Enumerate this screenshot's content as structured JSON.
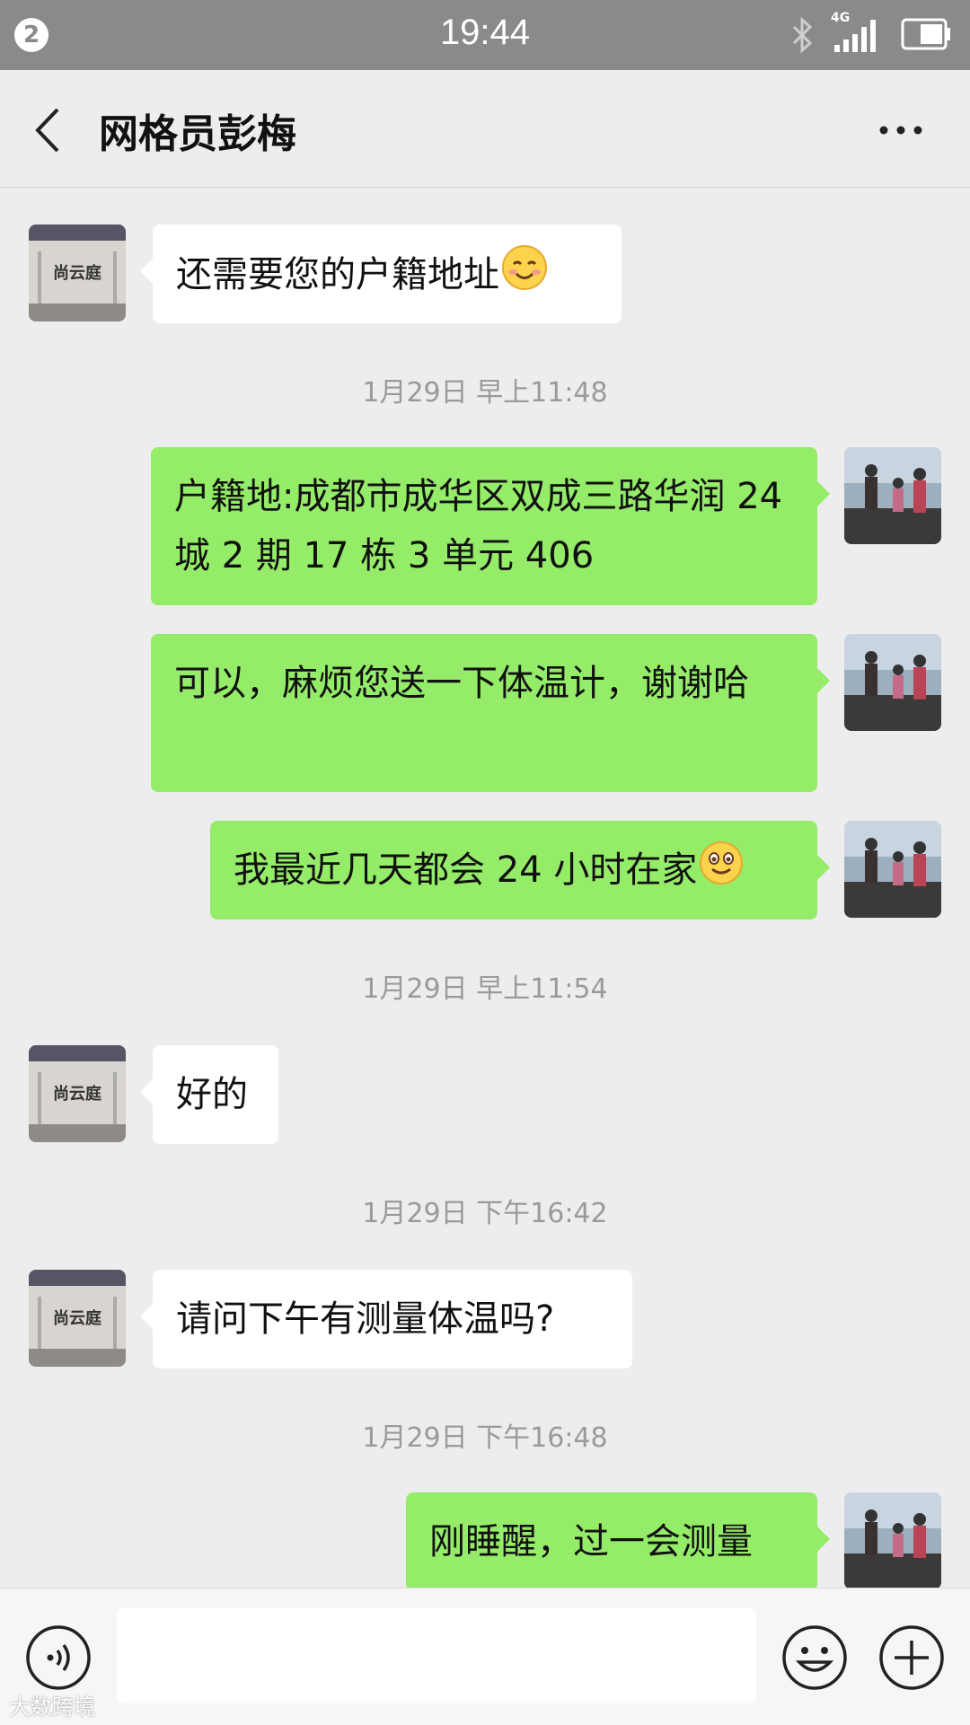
{
  "status_bar": {
    "notification_count": "2",
    "time": "19:44",
    "network": "4G"
  },
  "header": {
    "title": "网格员彭梅"
  },
  "messages": [
    {
      "side": "in",
      "text": "还需要您的户籍地址",
      "emoji": "blush-emoji"
    },
    {
      "type": "time",
      "text": "1月29日 早上11:48"
    },
    {
      "side": "out",
      "text": "户籍地:成都市成华区双成三路华润 24 城 2 期 17 栋 3 单元 406"
    },
    {
      "side": "out",
      "text": "可以，麻烦您送一下体温计，谢谢哈"
    },
    {
      "side": "out",
      "text": "我最近几天都会 24 小时在家",
      "emoji": "smile-emoji"
    },
    {
      "type": "time",
      "text": "1月29日 早上11:54"
    },
    {
      "side": "in",
      "text": "好的"
    },
    {
      "type": "time",
      "text": "1月29日 下午16:42"
    },
    {
      "side": "in",
      "text": "请问下午有测量体温吗?"
    },
    {
      "type": "time",
      "text": "1月29日 下午16:48"
    },
    {
      "side": "out",
      "text": "刚睡醒，过一会测量"
    }
  ],
  "input_bar": {
    "value": "",
    "placeholder": ""
  },
  "avatar_in_sign_text": "尚云庭",
  "watermark": "大数跨境",
  "colors": {
    "outgoing_bubble": "#95ec69",
    "incoming_bubble": "#ffffff",
    "background": "#ededed",
    "status_bar": "#8a8a8a"
  }
}
